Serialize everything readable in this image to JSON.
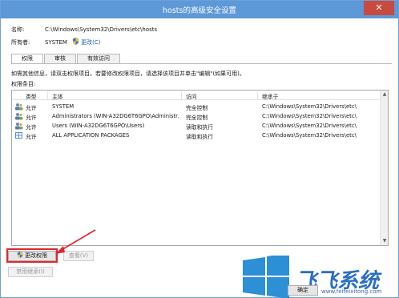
{
  "window": {
    "title": "hosts的高级安全设置",
    "close_glyph": "✕"
  },
  "info": {
    "name_label": "名称:",
    "name_value": "C:\\Windows\\System32\\Drivers\\etc\\hosts",
    "owner_label": "所有者:",
    "owner_value": "SYSTEM",
    "change_link": "更改(C)"
  },
  "tabs": [
    {
      "label": "权限",
      "active": true
    },
    {
      "label": "审核",
      "active": false
    },
    {
      "label": "有效访问",
      "active": false
    }
  ],
  "hint": "如需其他信息，请双击权限项目。若要修改权限项目，请选择该项目并单击\"编辑\"(如果可用)。",
  "entries_label": "权限条目:",
  "columns": {
    "type": "类型",
    "principal": "主体",
    "access": "访问",
    "inherited_from": "继承于"
  },
  "entries": [
    {
      "icon": "user-group-icon",
      "type": "允许",
      "principal": "SYSTEM",
      "access": "完全控制",
      "inherited_from": "C:\\Windows\\System32\\Drivers\\etc\\"
    },
    {
      "icon": "user-group-icon",
      "type": "允许",
      "principal": "Administrators (WIN-A32DG6T6GPO\\Administr...",
      "access": "完全控制",
      "inherited_from": "C:\\Windows\\System32\\Drivers\\etc\\"
    },
    {
      "icon": "user-group-icon",
      "type": "允许",
      "principal": "Users (WIN-A32DG6T6GPO\\Users)",
      "access": "读取和执行",
      "inherited_from": "C:\\Windows\\System32\\Drivers\\etc\\"
    },
    {
      "icon": "packages-icon",
      "type": "允许",
      "principal": "ALL APPLICATION PACKAGES",
      "access": "读取和执行",
      "inherited_from": "C:\\Windows\\System32\\Drivers\\etc\\"
    }
  ],
  "buttons": {
    "change_permissions": "更改权限",
    "view": "查看(V)",
    "disable_inheritance": "禁用继承(I)",
    "ok": "确定"
  },
  "watermark": {
    "text": "www.feifeixitong.com",
    "brand": "飞飞系统"
  },
  "colors": {
    "titlebar": "#5d98d8",
    "highlight": "#e3262b",
    "link": "#1b5fb7"
  }
}
